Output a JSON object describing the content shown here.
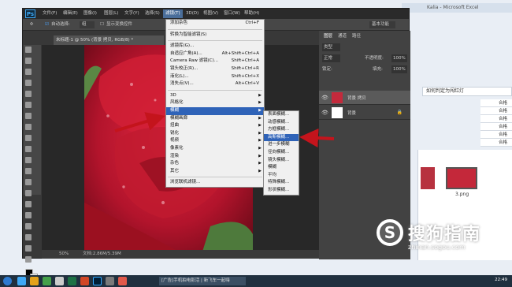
{
  "excel": {
    "title": "Kalia - Microsoft Excel",
    "cell_text": "如何判定为闯红灯",
    "values": [
      "合格",
      "合格",
      "合格",
      "合格",
      "合格",
      "合格",
      "合格",
      "合格"
    ],
    "file_label": "3.png"
  },
  "ps": {
    "logo": "Ps",
    "menus": [
      "文件(F)",
      "编辑(E)",
      "图像(I)",
      "图层(L)",
      "文字(Y)",
      "选择(S)",
      "滤镜(T)",
      "3D(D)",
      "视图(V)",
      "窗口(W)",
      "帮助(H)"
    ],
    "options": {
      "auto_select": "自动选择:",
      "group": "组",
      "transform": "显示变换控件",
      "workspace": "基本功能"
    },
    "doc_tab": "未标题-1 @ 50% (背景 拷贝, RGB/8) *",
    "status_zoom": "50%",
    "status_doc": "文档:2.86M/5.39M",
    "panels": {
      "tabs": [
        "图层",
        "通道",
        "路径"
      ],
      "kind": "类型",
      "mode": "正常",
      "opacity_label": "不透明度:",
      "opacity": "100%",
      "lock": "锁定:",
      "fill_label": "填充:",
      "fill": "100%",
      "layers": [
        {
          "name": "背景 拷贝",
          "color": "#c32a3c"
        },
        {
          "name": "背景",
          "color": "#ffffff"
        }
      ]
    }
  },
  "filter_menu": {
    "items": [
      {
        "label": "添加杂色",
        "shortcut": "Ctrl+F"
      },
      {
        "sep": true
      },
      {
        "label": "转换为智能滤镜(S)"
      },
      {
        "sep": true
      },
      {
        "label": "滤镜库(G)..."
      },
      {
        "label": "自适应广角(A)...",
        "shortcut": "Alt+Shift+Ctrl+A"
      },
      {
        "label": "Camera Raw 滤镜(C)...",
        "shortcut": "Shift+Ctrl+A"
      },
      {
        "label": "镜头校正(R)...",
        "shortcut": "Shift+Ctrl+R"
      },
      {
        "label": "液化(L)...",
        "shortcut": "Shift+Ctrl+X"
      },
      {
        "label": "消失点(V)...",
        "shortcut": "Alt+Ctrl+V"
      },
      {
        "sep": true
      },
      {
        "label": "3D",
        "sub": true
      },
      {
        "label": "风格化",
        "sub": true
      },
      {
        "label": "模糊",
        "sub": true,
        "selected": true
      },
      {
        "label": "模糊画廊",
        "sub": true
      },
      {
        "label": "扭曲",
        "sub": true
      },
      {
        "label": "锐化",
        "sub": true
      },
      {
        "label": "视频",
        "sub": true
      },
      {
        "label": "像素化",
        "sub": true
      },
      {
        "label": "渲染",
        "sub": true
      },
      {
        "label": "杂色",
        "sub": true
      },
      {
        "label": "其它",
        "sub": true
      },
      {
        "sep": true
      },
      {
        "label": "浏览联机滤镜..."
      }
    ]
  },
  "blur_menu": {
    "items": [
      {
        "label": "表面模糊..."
      },
      {
        "label": "动感模糊..."
      },
      {
        "label": "方框模糊..."
      },
      {
        "label": "高斯模糊...",
        "selected": true
      },
      {
        "label": "进一步模糊"
      },
      {
        "label": "径向模糊..."
      },
      {
        "label": "镜头模糊..."
      },
      {
        "label": "模糊"
      },
      {
        "label": "平均"
      },
      {
        "label": "特殊模糊..."
      },
      {
        "label": "形状模糊..."
      }
    ]
  },
  "taskbar": {
    "window_label": "[广告]手机拍电影活 | 新飞车一起嗨",
    "clock": "22:49"
  },
  "watermark": {
    "text": "搜狗指南",
    "url": "zhinan.sogou.com",
    "logo": "S"
  },
  "colors": {
    "accent": "#2f63b8",
    "rose": "#b0122b",
    "arrow": "#c4141c"
  }
}
